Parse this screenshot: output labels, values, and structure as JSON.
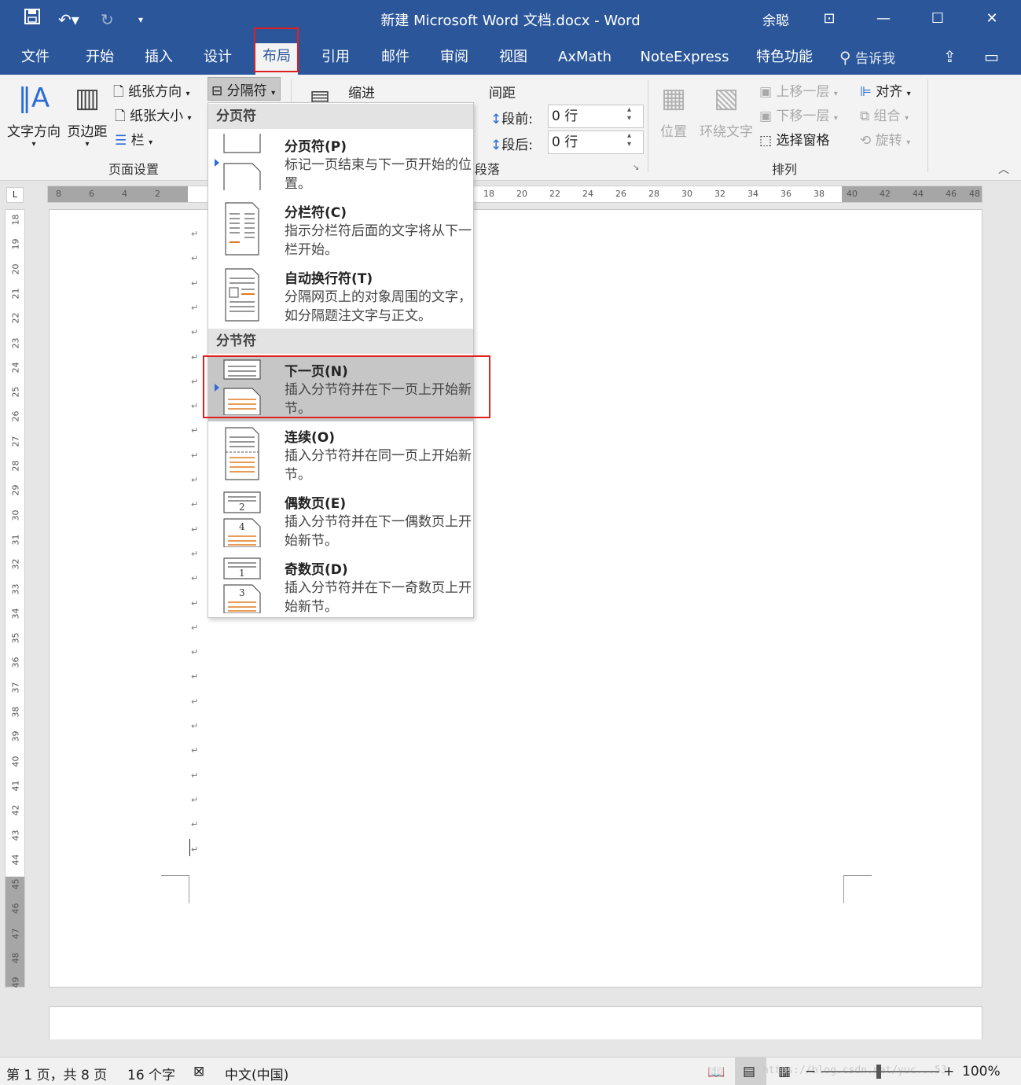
{
  "window": {
    "title": "新建 Microsoft Word 文档.docx  -  Word",
    "user": "余聪",
    "qat": [
      "save-icon",
      "undo-icon",
      "redo-icon",
      "customize-icon"
    ]
  },
  "tabs": [
    "文件",
    "开始",
    "插入",
    "设计",
    "布局",
    "引用",
    "邮件",
    "审阅",
    "视图",
    "AxMath",
    "NoteExpress",
    "特色功能"
  ],
  "active_tab": "布局",
  "tell_me": "告诉我",
  "ribbon": {
    "page_setup": {
      "text_direction": "文字方向",
      "margins": "页边距",
      "orientation": "纸张方向",
      "size": "纸张大小",
      "columns": "栏",
      "breaks": "分隔符",
      "label": "页面设置"
    },
    "paragraph": {
      "indent": "缩进",
      "spacing": "间距",
      "before_label": "段前:",
      "before_value": "0 行",
      "after_label": "段后:",
      "after_value": "0 行",
      "label": "段落"
    },
    "arrange": {
      "position": "位置",
      "wrap_text": "环绕文字",
      "bring_forward": "上移一层",
      "send_backward": "下移一层",
      "selection_pane": "选择窗格",
      "align": "对齐",
      "group": "组合",
      "rotate": "旋转",
      "label": "排列"
    }
  },
  "ruler": {
    "h_numbers": [
      "8",
      "6",
      "4",
      "2",
      "18",
      "20",
      "22",
      "24",
      "26",
      "28",
      "30",
      "32",
      "34",
      "36",
      "38",
      "40",
      "42",
      "44",
      "46",
      "48"
    ],
    "v_numbers": [
      "18",
      "19",
      "20",
      "21",
      "22",
      "23",
      "24",
      "25",
      "26",
      "27",
      "28",
      "29",
      "30",
      "31",
      "32",
      "33",
      "34",
      "35",
      "36",
      "37",
      "38",
      "39",
      "40",
      "41",
      "42",
      "43",
      "44",
      "45",
      "46",
      "47",
      "48",
      "49"
    ],
    "corner": "L"
  },
  "breaks_menu": {
    "page_breaks_header": "分页符",
    "section_breaks_header": "分节符",
    "items": [
      {
        "title": "分页符(P)",
        "desc": "标记一页结束与下一页开始的位置。"
      },
      {
        "title": "分栏符(C)",
        "desc": "指示分栏符后面的文字将从下一栏开始。"
      },
      {
        "title": "自动换行符(T)",
        "desc": "分隔网页上的对象周围的文字，如分隔题注文字与正文。"
      },
      {
        "title": "下一页(N)",
        "desc": "插入分节符并在下一页上开始新节。"
      },
      {
        "title": "连续(O)",
        "desc": "插入分节符并在同一页上开始新节。"
      },
      {
        "title": "偶数页(E)",
        "desc": "插入分节符并在下一偶数页上开始新节。"
      },
      {
        "title": "奇数页(D)",
        "desc": "插入分节符并在下一奇数页上开始新节。"
      }
    ],
    "icon_numbers": {
      "even_top": "2",
      "even_bottom": "4",
      "odd_top": "1",
      "odd_bottom": "3"
    }
  },
  "status": {
    "page": "第 1 页，共 8 页",
    "words": "16 个字",
    "language": "中文(中国)",
    "zoom": "100%",
    "watermark": "https://blog.csdn.net/yuc...53"
  },
  "colors": {
    "accent": "#2b579a",
    "highlight": "#e02020",
    "menu_selected": "#c6c6c6"
  }
}
